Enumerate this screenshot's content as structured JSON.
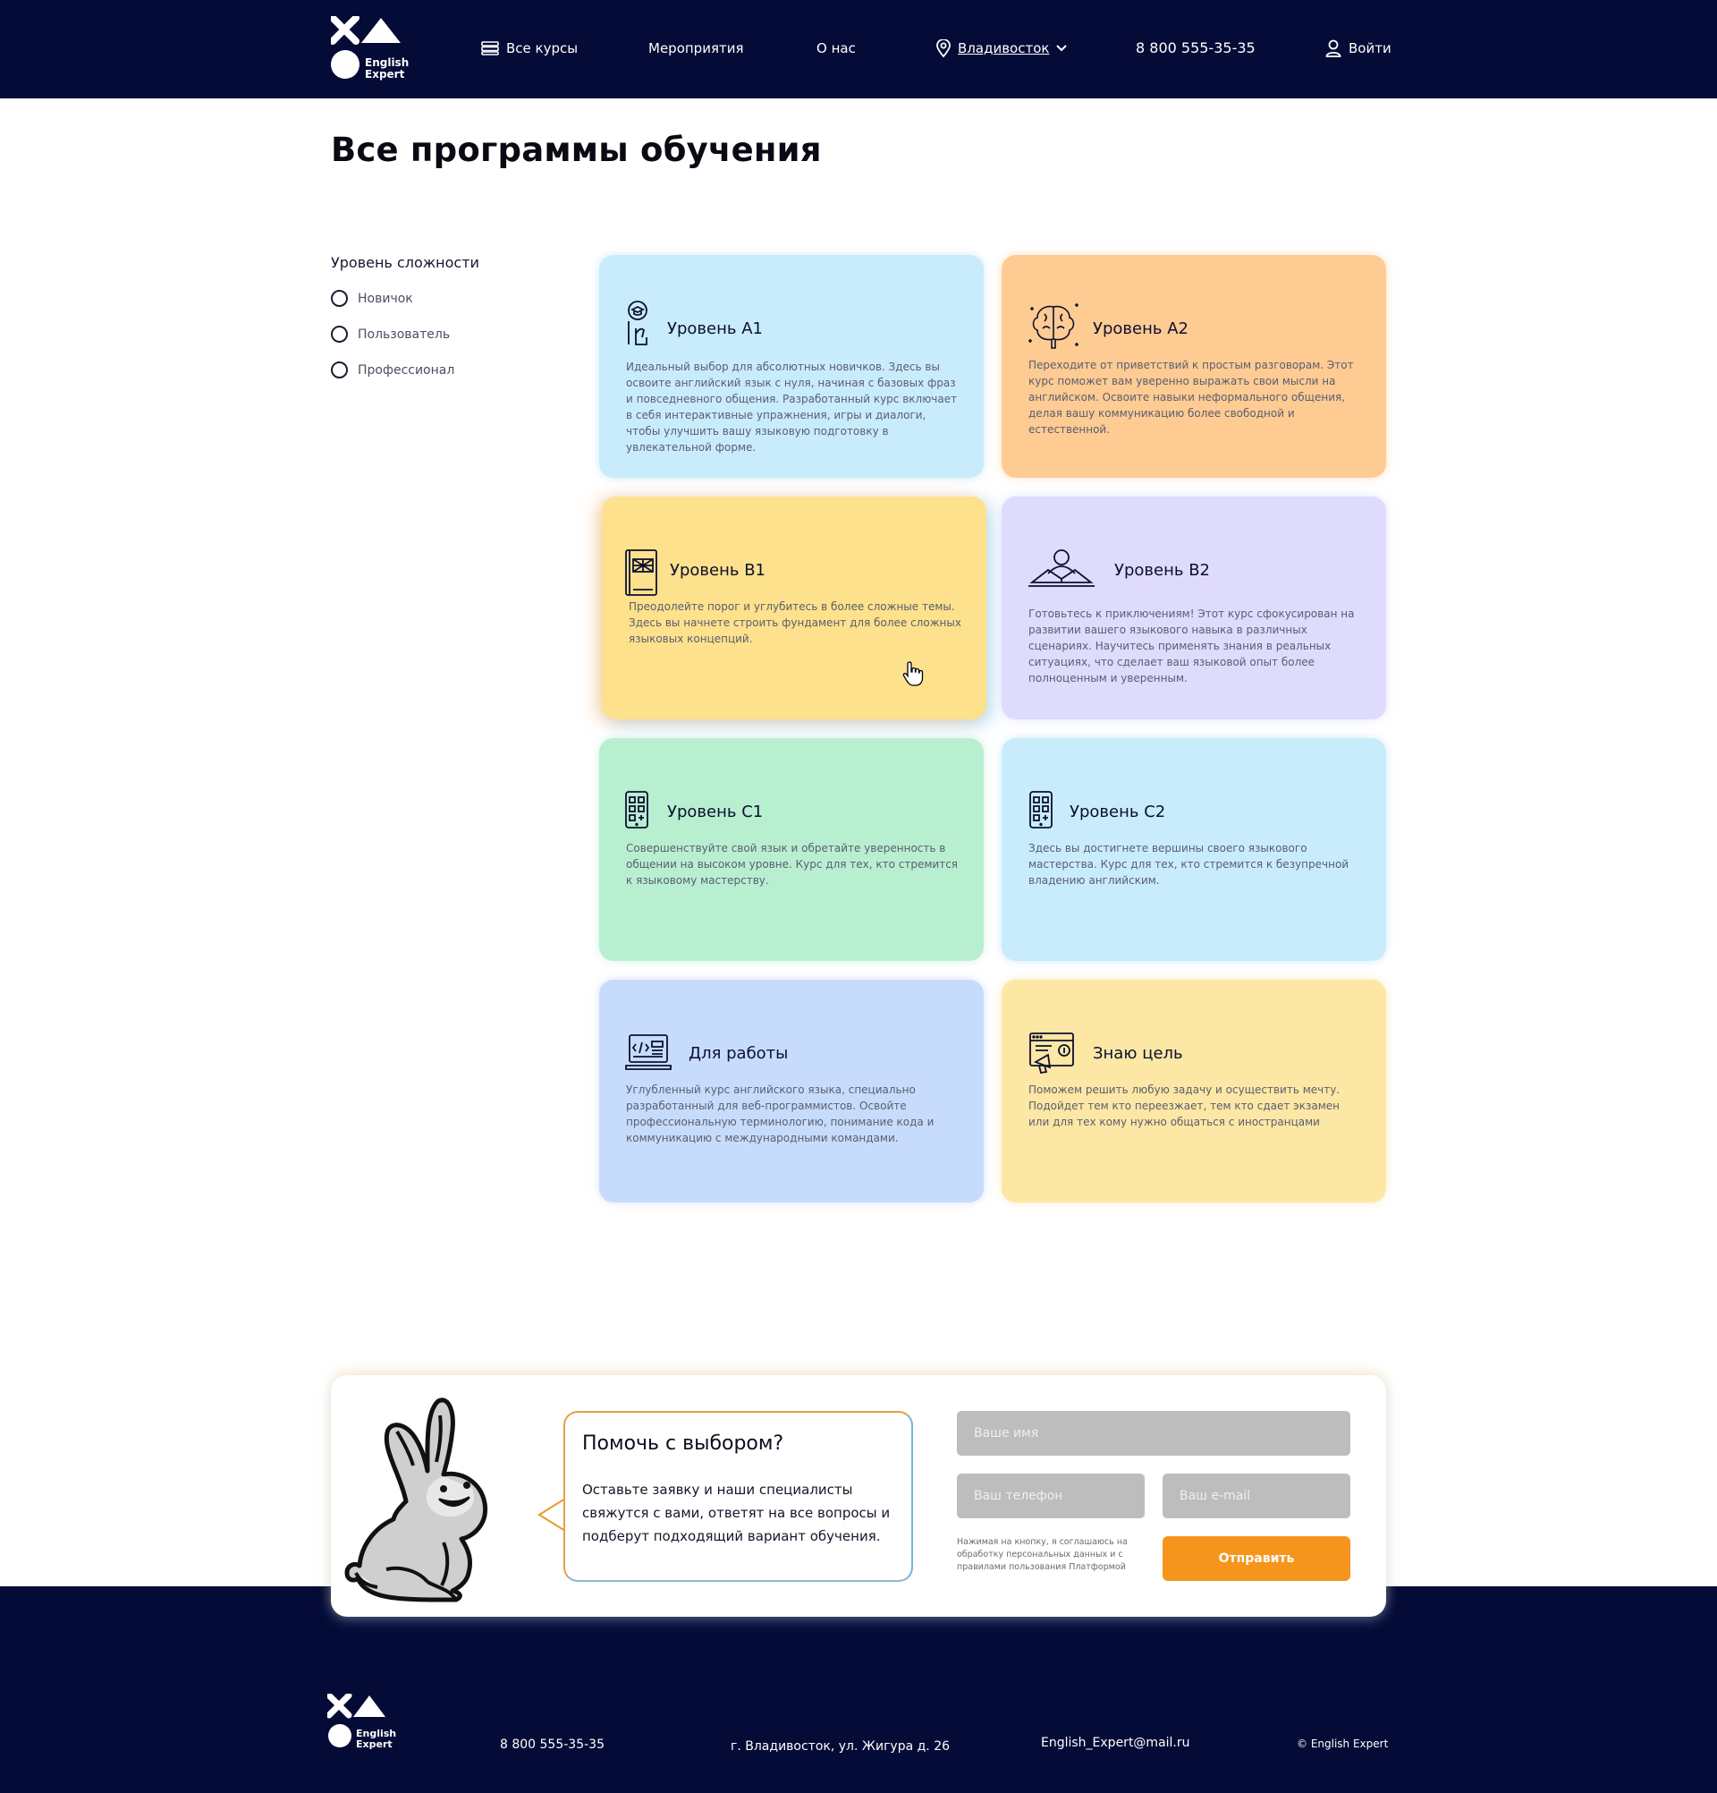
{
  "header": {
    "logo_text_line1": "English",
    "logo_text_line2": "Expert",
    "nav": {
      "courses": "Все курсы",
      "events": "Мероприятия",
      "about": "О нас",
      "city": "Владивосток",
      "phone": "8 800 555-35-35",
      "login": "Войти"
    }
  },
  "main": {
    "title": "Все программы обучения",
    "filter": {
      "title": "Уровень сложности",
      "options": [
        "Новичок",
        "Пользователь",
        "Профессионал"
      ]
    },
    "cards": [
      {
        "title": "Уровень A1",
        "icon": "student-icon",
        "description": "Идеальный выбор для абсолютных новичков. Здесь вы освоите английский язык с нуля, начиная с базовых фраз и повседневного общения. Разработанный курс включает в себя интерактивные упражнения, игры и диалоги, чтобы улучшить вашу языковую подготовку в увлекательной форме.",
        "color": "#c8ecfb"
      },
      {
        "title": "Уровень A2",
        "icon": "brain-icon",
        "description": "Переходите от приветствий к простым разговорам. Этот курс поможет вам уверенно выражать свои мысли на английском. Освоите навыки неформального общения, делая вашу коммуникацию более свободной и естественной.",
        "color": "#fecb93"
      },
      {
        "title": "Уровень B1",
        "icon": "book-flag-icon",
        "description": "Преодолейте порог и углубитесь в более сложные темы. Здесь вы начнете строить фундамент для более сложных языковых концепций.",
        "color": "#fde18c"
      },
      {
        "title": "Уровень B2",
        "icon": "reader-icon",
        "description": "Готовьтесь к приключениям! Этот курс сфокусирован на развитии вашего языкового навыка в различных сценариях. Научитесь применять знания в реальных ситуациях, что сделает ваш языковой опыт более полноценным и уверенным.",
        "color": "#dedbfd"
      },
      {
        "title": "Уровень C1",
        "icon": "phone-apps-icon",
        "description": "Совершенствуйте свой язык и обретайте уверенность в общении на высоком уровне. Курс для тех, кто стремится к языковому мастерству.",
        "color": "#b8efd0"
      },
      {
        "title": "Уровень C2",
        "icon": "phone-apps-icon",
        "description": "Здесь вы достигнете вершины своего языкового мастерства. Курс для тех, кто стремится к безупречной владению английским.",
        "color": "#c8ecfb"
      },
      {
        "title": "Для работы",
        "icon": "laptop-code-icon",
        "description": "Углубленный курс английского языка, специально разработанный для веб-программистов. Освойте профессиональную терминологию, понимание кода и коммуникацию с международными командами.",
        "color": "#c7dcfd"
      },
      {
        "title": "Знаю цель",
        "icon": "target-marketing-icon",
        "description": "Поможем решить любую задачу и осуществить мечту. Подойдет тем кто переезжает, тем кто сдает экзамен или для тех кому нужно общаться с иностранцами",
        "color": "#fde7a5"
      }
    ]
  },
  "help": {
    "title": "Помочь с выбором?",
    "text": "Оставьте заявку и наши специалисты свяжутся с вами, ответят на все вопросы и подберут подходящий вариант обучения.",
    "name_placeholder": "Ваше имя",
    "phone_placeholder": "Ваш телефон",
    "email_placeholder": "Ваш e-mail",
    "consent": "Нажимая на кнопку, я соглашаюсь на обработку персональных данных и с правилами пользования Платформой",
    "submit_label": "Отправить"
  },
  "footer": {
    "logo_text_line1": "English",
    "logo_text_line2": "Expert",
    "phone": "8 800 555-35-35",
    "address": "г. Владивосток, ул. Жигура д. 26",
    "email": "English_Expert@mail.ru",
    "copyright": "© English Expert"
  },
  "colors": {
    "header_bg": "#040b36",
    "accent": "#f5951e"
  }
}
